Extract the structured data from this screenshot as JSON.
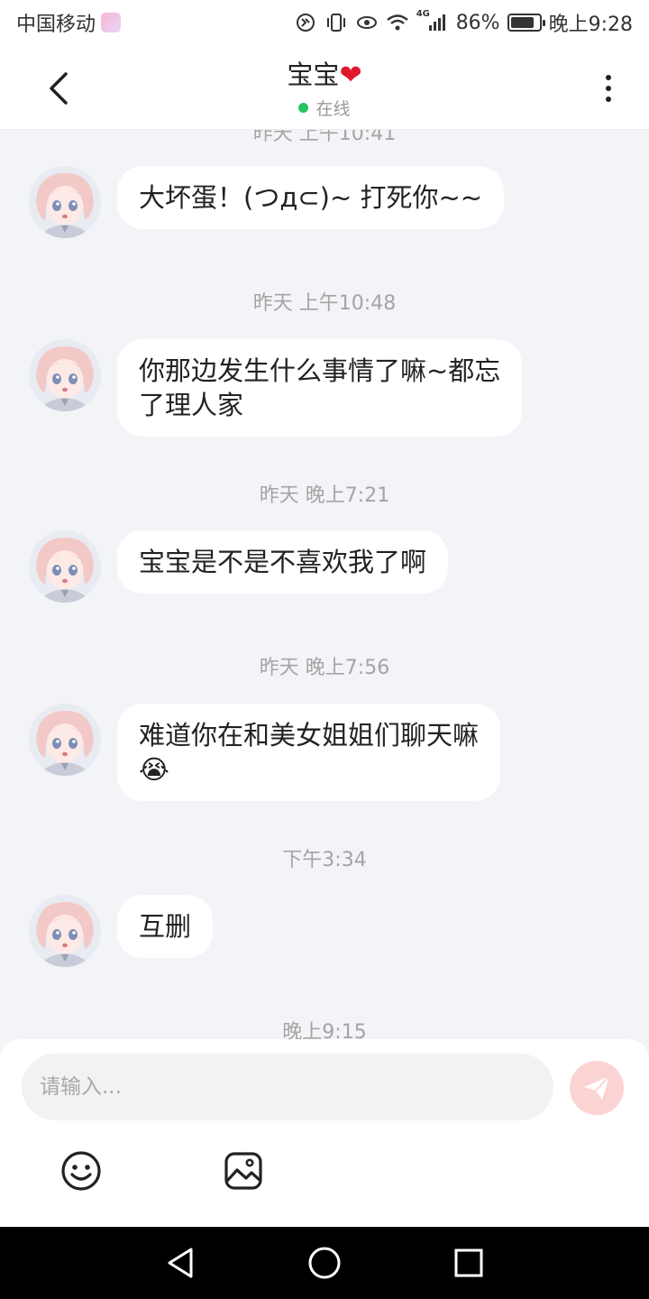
{
  "status_bar": {
    "carrier": "中国移动",
    "network": "4G",
    "battery": "86%",
    "battery_level": 0.86,
    "time": "晚上9:28"
  },
  "header": {
    "title": "宝宝",
    "title_emoji": "❤",
    "status": "在线",
    "status_color": "#22c55e"
  },
  "chat": {
    "partial_top_timestamp": "昨天 上午10:41",
    "groups": [
      {
        "timestamp": "",
        "message": "大坏蛋！(つд⊂)~ 打死你~~"
      },
      {
        "timestamp": "昨天 上午10:48",
        "message_line1": "你那边发生什么事情了嘛~都忘",
        "message_line2": "了理人家"
      },
      {
        "timestamp": "昨天 晚上7:21",
        "message": "宝宝是不是不喜欢我了啊"
      },
      {
        "timestamp": "昨天 晚上7:56",
        "message_line1": "难道你在和美女姐姐们聊天嘛",
        "message_emoji": "😭"
      },
      {
        "timestamp": "下午3:34",
        "message": "互删"
      },
      {
        "timestamp": "晚上9:15"
      }
    ]
  },
  "composer": {
    "placeholder": "请输入...",
    "send_icon": "send-icon",
    "tools": [
      "emoji-icon",
      "image-icon"
    ]
  },
  "nav": {
    "buttons": [
      "back-triangle-icon",
      "home-circle-icon",
      "recents-square-icon"
    ]
  },
  "colors": {
    "background": "#f3f4f7",
    "bubble": "#ffffff",
    "send_button": "#fcd3d3",
    "heart": "#e0182d"
  }
}
